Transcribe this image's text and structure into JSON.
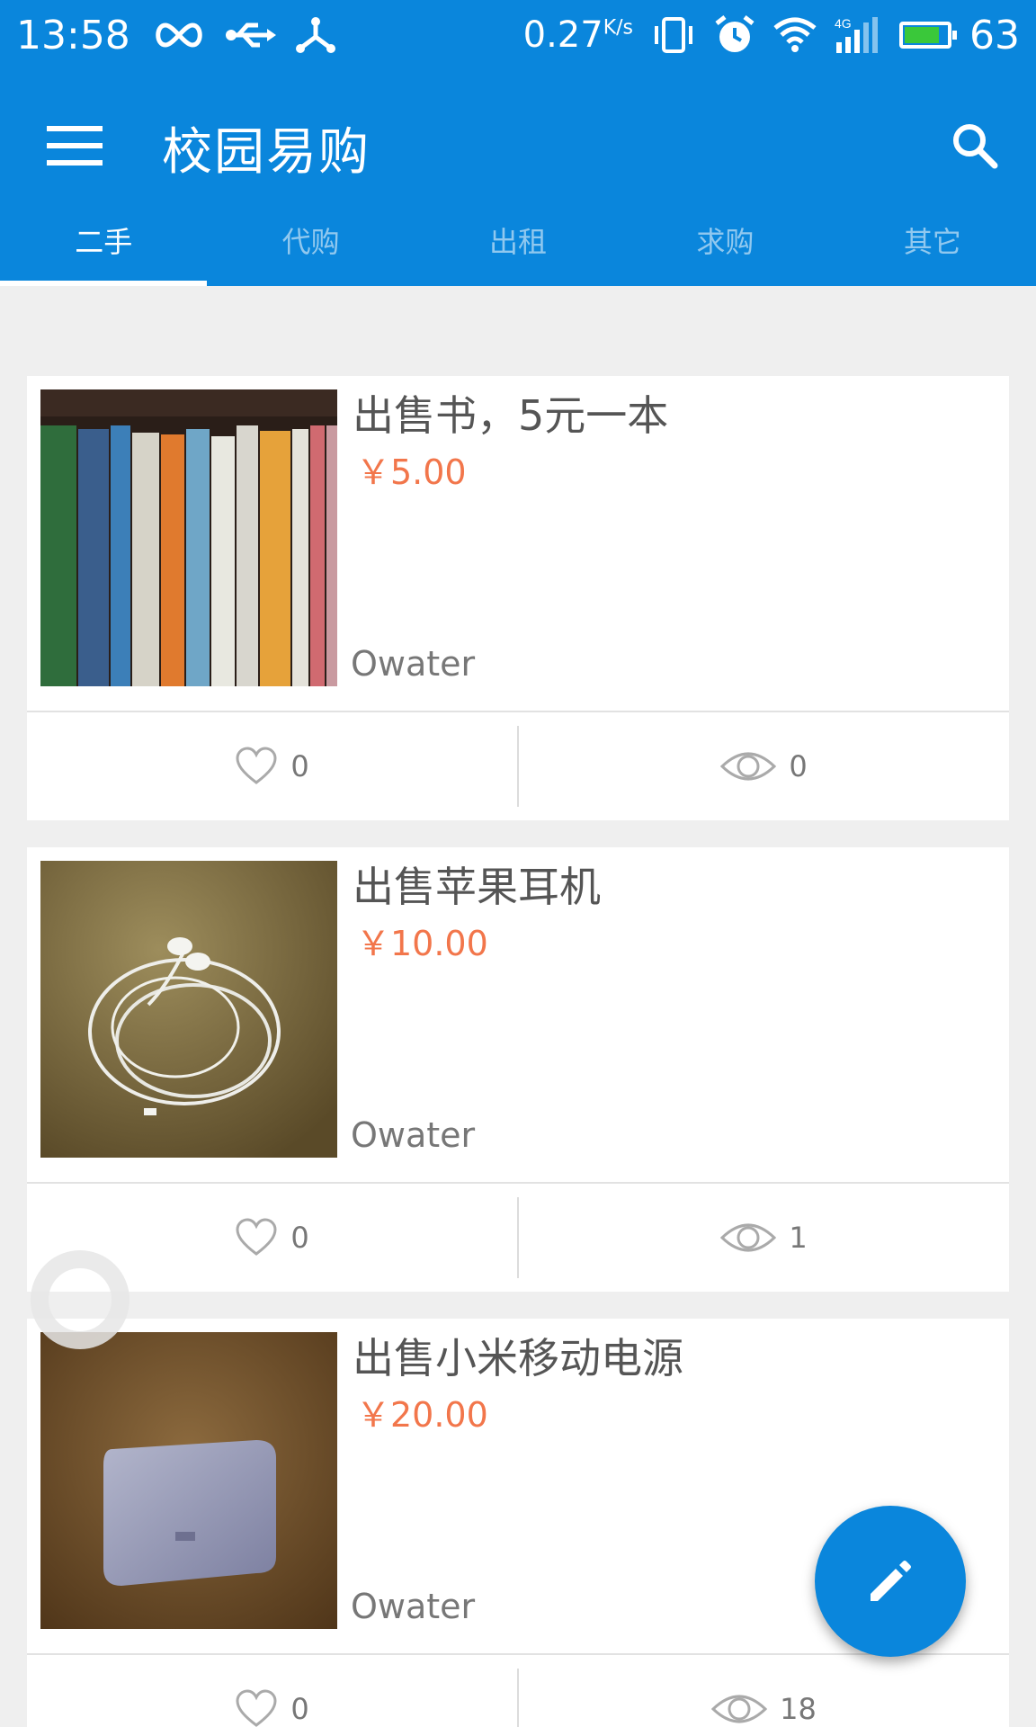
{
  "status_bar": {
    "time": "13:58",
    "speed": "0.27",
    "speed_unit": "K/s",
    "battery": "63",
    "icons": [
      "infinity-icon",
      "usb-icon",
      "share-icon",
      "vibrate-icon",
      "alarm-icon",
      "wifi-icon",
      "signal-4g-icon",
      "battery-icon"
    ]
  },
  "app_bar": {
    "title": "校园易购",
    "menu_icon": "menu-icon",
    "search_icon": "search-icon"
  },
  "tabs": [
    {
      "label": "二手",
      "active": true
    },
    {
      "label": "代购",
      "active": false
    },
    {
      "label": "出租",
      "active": false
    },
    {
      "label": "求购",
      "active": false
    },
    {
      "label": "其它",
      "active": false
    }
  ],
  "listings": [
    {
      "title": "出售书，5元一本",
      "price": "￥5.00",
      "seller": "Owater",
      "likes": "0",
      "views": "0",
      "image": "books-photo"
    },
    {
      "title": "出售苹果耳机",
      "price": "￥10.00",
      "seller": "Owater",
      "likes": "0",
      "views": "1",
      "image": "earphones-photo"
    },
    {
      "title": "出售小米移动电源",
      "price": "￥20.00",
      "seller": "Owater",
      "likes": "0",
      "views": "18",
      "image": "power-bank-photo"
    }
  ],
  "fab": {
    "icon": "edit-icon"
  },
  "colors": {
    "primary": "#0a86dc",
    "price": "#f2764b",
    "background": "#efefef"
  }
}
